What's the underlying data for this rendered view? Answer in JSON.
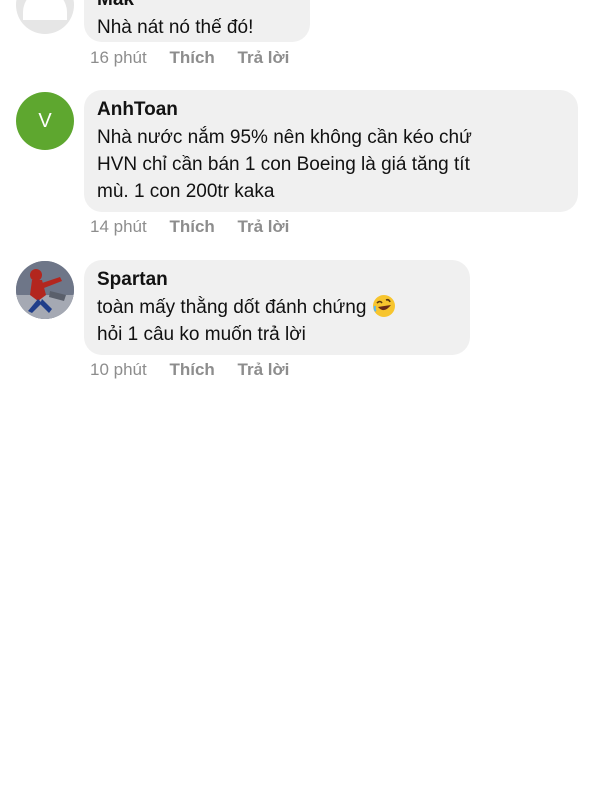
{
  "comments": [
    {
      "author": "Mak",
      "avatar": "default-avatar",
      "text": "Nhà nát nó thế đó!",
      "time": "16 phút",
      "like_label": "Thích",
      "reply_label": "Trả lời"
    },
    {
      "author": "AnhToan",
      "avatar": "letter-avatar",
      "avatar_letter": "V",
      "avatar_color": "#5ea72f",
      "text_lines": [
        "Nhà nước nắm 95% nên không cần kéo chứ",
        "HVN chỉ cần bán 1 con Boeing là giá tăng tít",
        "mù. 1 con 200tr kaka"
      ],
      "time": "14 phút",
      "like_label": "Thích",
      "reply_label": "Trả lời"
    },
    {
      "author": "Spartan",
      "avatar": "photo-avatar",
      "text_lines": [
        "toàn mấy thằng dốt đánh chứng",
        "hỏi 1 câu ko muốn trả lời"
      ],
      "emoji": "rolling-on-floor-laughing-emoji",
      "time": "10 phút",
      "like_label": "Thích",
      "reply_label": "Trả lời"
    }
  ],
  "colors": {
    "bubble": "#f0f0f0",
    "meta_text": "#8d8d8d",
    "author_text": "#121212"
  }
}
